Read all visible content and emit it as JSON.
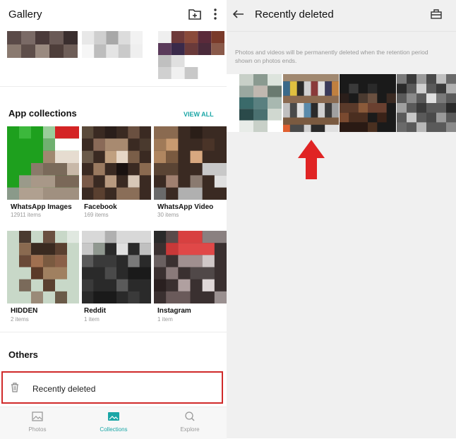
{
  "left_panel": {
    "title": "Gallery",
    "icons": {
      "add_album": "add-folder-icon",
      "menu": "more-vert-icon"
    },
    "app_collections": {
      "heading": "App collections",
      "view_all": "VIEW ALL",
      "items": [
        {
          "name": "WhatsApp Images",
          "count": "12911 items"
        },
        {
          "name": "Facebook",
          "count": "169 items"
        },
        {
          "name": "WhatsApp Video",
          "count": "30 items"
        },
        {
          "name": "HIDDEN",
          "count": "2 items"
        },
        {
          "name": "Reddit",
          "count": "1 item"
        },
        {
          "name": "Instagram",
          "count": "1 item"
        }
      ]
    },
    "others": {
      "heading": "Others",
      "recently_deleted": "Recently deleted"
    },
    "bottom_nav": [
      {
        "label": "Photos",
        "icon": "photo-icon",
        "active": false
      },
      {
        "label": "Collections",
        "icon": "collections-icon",
        "active": true
      },
      {
        "label": "Explore",
        "icon": "explore-icon",
        "active": false
      }
    ]
  },
  "right_panel": {
    "title": "Recently deleted",
    "icons": {
      "back": "back-arrow-icon",
      "toolbox": "toolbox-icon"
    },
    "notice": "Photos and videos will be permanently deleted when the retention period shown on photos ends."
  },
  "colors": {
    "accent": "#1aa6a6",
    "highlight_border": "#d02a2a",
    "arrow": "#e02424"
  }
}
